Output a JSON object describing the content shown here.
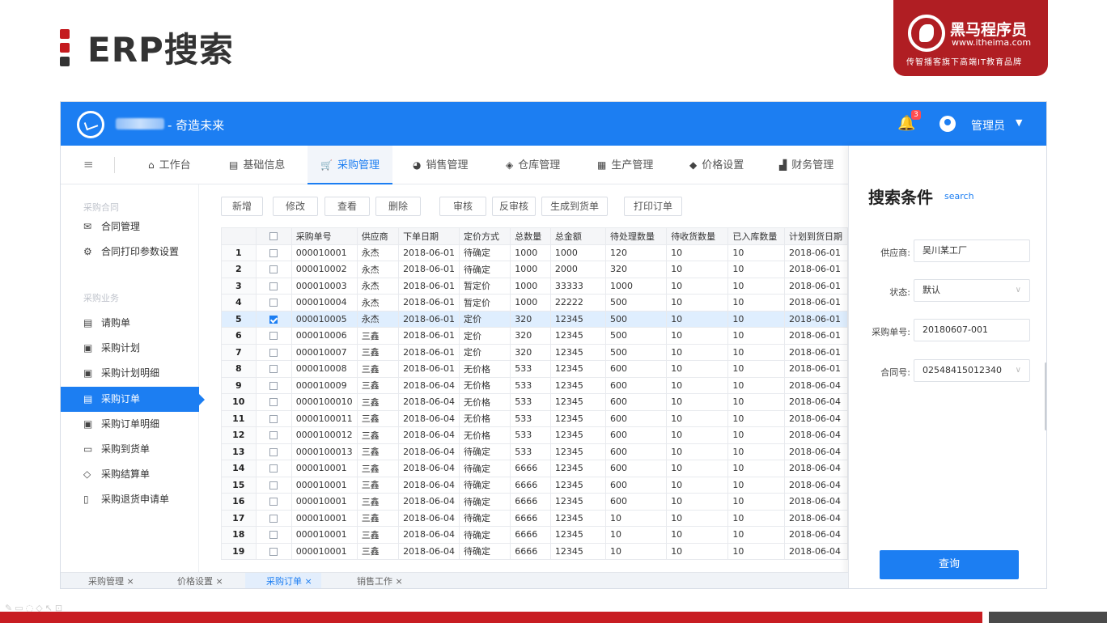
{
  "slide": {
    "title": "ERP搜索"
  },
  "brand": {
    "name": "黑马程序员",
    "url": "www.itheima.com",
    "slogan": "传智播客旗下高端IT教育品牌"
  },
  "app": {
    "name": "- 奇造未来",
    "notifications": "3",
    "user": "管理员"
  },
  "nav": [
    {
      "label": "工作台",
      "icon": "home-icon"
    },
    {
      "label": "基础信息",
      "icon": "document-icon"
    },
    {
      "label": "采购管理",
      "icon": "cart-icon",
      "active": true
    },
    {
      "label": "销售管理",
      "icon": "chart-pie-icon"
    },
    {
      "label": "仓库管理",
      "icon": "layers-icon"
    },
    {
      "label": "生产管理",
      "icon": "grid-icon"
    },
    {
      "label": "价格设置",
      "icon": "tag-icon"
    },
    {
      "label": "财务管理",
      "icon": "finance-icon"
    }
  ],
  "sidebar": {
    "group1": "采购合同",
    "group2": "采购业务",
    "items": [
      {
        "label": "合同管理",
        "icon": "mail-icon"
      },
      {
        "label": "合同打印参数设置",
        "icon": "settings-icon"
      },
      {
        "label": "请购单",
        "icon": "file-icon"
      },
      {
        "label": "采购计划",
        "icon": "plan-icon"
      },
      {
        "label": "采购计划明细",
        "icon": "plan-detail-icon"
      },
      {
        "label": "采购订单",
        "icon": "order-icon",
        "active": true
      },
      {
        "label": "采购订单明细",
        "icon": "order-detail-icon"
      },
      {
        "label": "采购到货单",
        "icon": "folder-icon"
      },
      {
        "label": "采购结算单",
        "icon": "tag-icon"
      },
      {
        "label": "采购退货申请单",
        "icon": "return-icon"
      }
    ]
  },
  "toolbar": [
    "新增",
    "修改",
    "查看",
    "删除",
    "审核",
    "反审核",
    "生成到货单",
    "打印订单"
  ],
  "table": {
    "headers": [
      "",
      "",
      "采购单号",
      "供应商",
      "下单日期",
      "定价方式",
      "总数量",
      "总金额",
      "待处理数量",
      "待收货数量",
      "已入库数量",
      "计划到货日期"
    ],
    "rows": [
      [
        "1",
        "000010001",
        "永杰",
        "2018-06-01",
        "待确定",
        "1000",
        "1000",
        "120",
        "10",
        "10",
        "2018-06-01"
      ],
      [
        "2",
        "000010002",
        "永杰",
        "2018-06-01",
        "待确定",
        "1000",
        "2000",
        "320",
        "10",
        "10",
        "2018-06-01"
      ],
      [
        "3",
        "000010003",
        "永杰",
        "2018-06-01",
        "暂定价",
        "1000",
        "33333",
        "1000",
        "10",
        "10",
        "2018-06-01"
      ],
      [
        "4",
        "000010004",
        "永杰",
        "2018-06-01",
        "暂定价",
        "1000",
        "22222",
        "500",
        "10",
        "10",
        "2018-06-01"
      ],
      [
        "5",
        "000010005",
        "永杰",
        "2018-06-01",
        "定价",
        "320",
        "12345",
        "500",
        "10",
        "10",
        "2018-06-01"
      ],
      [
        "6",
        "000010006",
        "三鑫",
        "2018-06-01",
        "定价",
        "320",
        "12345",
        "500",
        "10",
        "10",
        "2018-06-01"
      ],
      [
        "7",
        "000010007",
        "三鑫",
        "2018-06-01",
        "定价",
        "320",
        "12345",
        "500",
        "10",
        "10",
        "2018-06-01"
      ],
      [
        "8",
        "000010008",
        "三鑫",
        "2018-06-01",
        "无价格",
        "533",
        "12345",
        "600",
        "10",
        "10",
        "2018-06-01"
      ],
      [
        "9",
        "000010009",
        "三鑫",
        "2018-06-04",
        "无价格",
        "533",
        "12345",
        "600",
        "10",
        "10",
        "2018-06-04"
      ],
      [
        "10",
        "0000100010",
        "三鑫",
        "2018-06-04",
        "无价格",
        "533",
        "12345",
        "600",
        "10",
        "10",
        "2018-06-04"
      ],
      [
        "11",
        "0000100011",
        "三鑫",
        "2018-06-04",
        "无价格",
        "533",
        "12345",
        "600",
        "10",
        "10",
        "2018-06-04"
      ],
      [
        "12",
        "0000100012",
        "三鑫",
        "2018-06-04",
        "无价格",
        "533",
        "12345",
        "600",
        "10",
        "10",
        "2018-06-04"
      ],
      [
        "13",
        "0000100013",
        "三鑫",
        "2018-06-04",
        "待确定",
        "533",
        "12345",
        "600",
        "10",
        "10",
        "2018-06-04"
      ],
      [
        "14",
        "000010001",
        "三鑫",
        "2018-06-04",
        "待确定",
        "6666",
        "12345",
        "600",
        "10",
        "10",
        "2018-06-04"
      ],
      [
        "15",
        "000010001",
        "三鑫",
        "2018-06-04",
        "待确定",
        "6666",
        "12345",
        "600",
        "10",
        "10",
        "2018-06-04"
      ],
      [
        "16",
        "000010001",
        "三鑫",
        "2018-06-04",
        "待确定",
        "6666",
        "12345",
        "600",
        "10",
        "10",
        "2018-06-04"
      ],
      [
        "17",
        "000010001",
        "三鑫",
        "2018-06-04",
        "待确定",
        "6666",
        "12345",
        "10",
        "10",
        "10",
        "2018-06-04"
      ],
      [
        "18",
        "000010001",
        "三鑫",
        "2018-06-04",
        "待确定",
        "6666",
        "12345",
        "10",
        "10",
        "10",
        "2018-06-04"
      ],
      [
        "19",
        "000010001",
        "三鑫",
        "2018-06-04",
        "待确定",
        "6666",
        "12345",
        "10",
        "10",
        "10",
        "2018-06-04"
      ]
    ],
    "selected_row": 5
  },
  "panel": {
    "title": "搜索条件",
    "subtitle": "search",
    "fields": [
      {
        "label": "供应商:",
        "value": "吴川某工厂",
        "dropdown": false
      },
      {
        "label": "状态:",
        "value": "默认",
        "dropdown": true
      },
      {
        "label": "采购单号:",
        "value": "20180607-001",
        "dropdown": false
      },
      {
        "label": "合同号:",
        "value": "02548415012340",
        "dropdown": true
      }
    ],
    "button": "查询"
  },
  "bottom_tabs": [
    {
      "label": "采购管理 ×"
    },
    {
      "label": "价格设置 ×"
    },
    {
      "label": "采购订单 ×",
      "active": true
    },
    {
      "label": "销售工作 ×"
    }
  ],
  "colors": {
    "primary": "#1c7ef2",
    "brand_red": "#c81d22"
  }
}
